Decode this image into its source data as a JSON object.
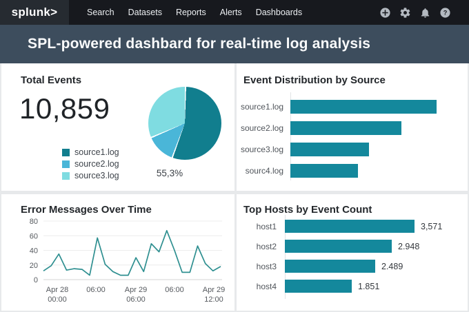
{
  "nav": {
    "logo": "splunk>",
    "items": [
      "Search",
      "Datasets",
      "Reports",
      "Alerts",
      "Dashboards"
    ],
    "icons": [
      "plus",
      "gear",
      "bell",
      "help"
    ]
  },
  "header": {
    "title": "SPL-powered dashbard for real-time log analysis"
  },
  "colors": {
    "nav_bg": "#17191e",
    "header_bg": "#3d4d5d",
    "bar_teal": "#14889c",
    "line_teal": "#2e8f90",
    "pie_dark": "#117e8e",
    "pie_mid": "#4ab6d8",
    "pie_light": "#7fdce1"
  },
  "chart_data": [
    {
      "type": "pie",
      "title": "Total Events",
      "total": "10,859",
      "callout": "55,3%",
      "slices": [
        {
          "label": "source1.log",
          "pct": 55.3,
          "color": "#117e8e"
        },
        {
          "label": "source2.log",
          "pct": 13.0,
          "color": "#4ab6d8"
        },
        {
          "label": "source3.log",
          "pct": 31.7,
          "color": "#7fdce1"
        }
      ]
    },
    {
      "type": "bar",
      "orientation": "horizontal",
      "title": "Event Distribution by Source",
      "categories": [
        "source1.log",
        "source2.log",
        "source3.log",
        "sourc4.log"
      ],
      "values": [
        100,
        76,
        54,
        46
      ],
      "note": "values are relative percents of longest bar; no numeric labels shown"
    },
    {
      "type": "line",
      "title": "Error Messages Over Time",
      "ylim": [
        0,
        80
      ],
      "y_ticks": [
        0,
        20,
        40,
        60,
        80
      ],
      "x_ticks": [
        [
          "Apr 28",
          "00:00"
        ],
        [
          "06:00"
        ],
        [
          "Apr 29",
          "06:00"
        ],
        [
          "06:00"
        ],
        [
          "Apr 29",
          "12:00"
        ]
      ],
      "values": [
        12,
        19,
        35,
        13,
        15,
        14,
        6,
        57,
        21,
        11,
        6,
        6,
        30,
        11,
        49,
        38,
        67,
        40,
        10,
        10,
        46,
        22,
        12,
        18
      ]
    },
    {
      "type": "bar",
      "orientation": "horizontal",
      "title": "Top Hosts by Event Count",
      "categories": [
        "host1",
        "host2",
        "host3",
        "host4"
      ],
      "values": [
        3571,
        2948,
        2489,
        1851
      ],
      "value_labels": [
        "3,571",
        "2.948",
        "2.489",
        "1.851"
      ]
    }
  ]
}
